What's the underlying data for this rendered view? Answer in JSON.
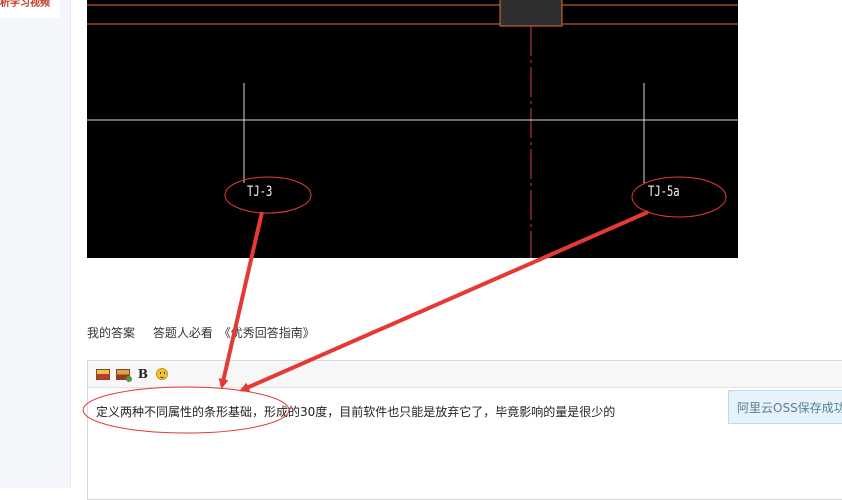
{
  "sidebar": {
    "link_label": "析学习视频"
  },
  "cad": {
    "labels": [
      {
        "text": "TJ-3"
      },
      {
        "text": "TJ-5a"
      }
    ]
  },
  "answer_area": {
    "links": [
      "我的答案",
      "答题人必看",
      "《优秀回答指南》"
    ]
  },
  "editor": {
    "toolbar_icons": [
      "insert-image-icon",
      "upload-image-icon",
      "bold-icon",
      "emoji-icon"
    ],
    "toolbar_bold_label": "B",
    "text": "定义两种不同属性的条形基础，形成的30度，目前软件也只能是放弃它了，毕竟影响的量是很少的"
  },
  "toast": {
    "text": "阿里云OSS保存成功"
  },
  "colors": {
    "annotation_red": "#e53935",
    "cad_orange": "#e07030",
    "cad_magenta": "#d6336c"
  }
}
